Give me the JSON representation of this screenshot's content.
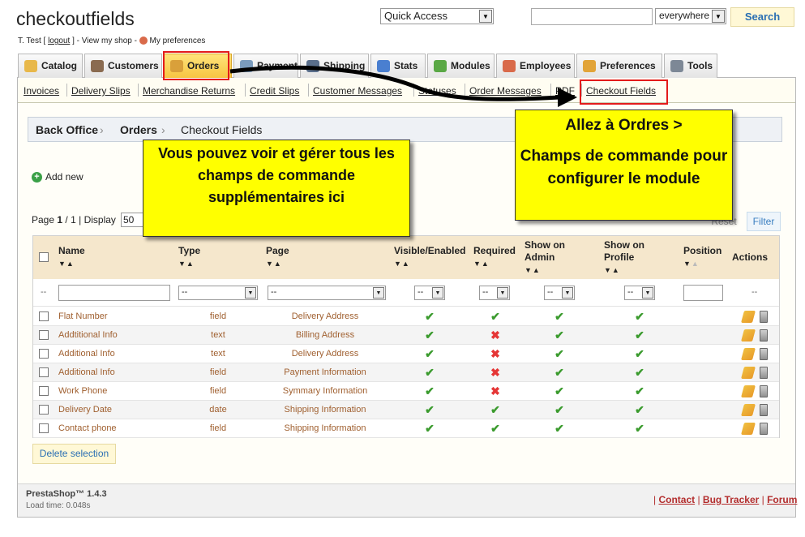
{
  "header": {
    "shop_title": "checkoutfields",
    "user_name": "T. Test",
    "logout_label": "logout",
    "view_shop_label": "View my shop",
    "preferences_label": "My preferences",
    "quick_access": "Quick Access",
    "search_value": "",
    "search_scope": "everywhere",
    "search_button": "Search"
  },
  "tabs": [
    {
      "label": "Catalog",
      "icon": "folder-icon",
      "color": "#e8b84a"
    },
    {
      "label": "Customers",
      "icon": "customer-icon",
      "color": "#8a6b50"
    },
    {
      "label": "Orders",
      "icon": "cart-icon",
      "color": "#d9a03a",
      "active": true
    },
    {
      "label": "Payment",
      "icon": "payment-icon",
      "color": "#7a9bbd"
    },
    {
      "label": "Shipping",
      "icon": "truck-icon",
      "color": "#5a6f8c"
    },
    {
      "label": "Stats",
      "icon": "stats-icon",
      "color": "#4a7fd0"
    },
    {
      "label": "Modules",
      "icon": "puzzle-icon",
      "color": "#5aa845"
    },
    {
      "label": "Employees",
      "icon": "employee-icon",
      "color": "#d96a4a"
    },
    {
      "label": "Preferences",
      "icon": "preferences-icon",
      "color": "#e2a438"
    },
    {
      "label": "Tools",
      "icon": "wrench-icon",
      "color": "#7d8896"
    }
  ],
  "subtabs": [
    "Invoices",
    "Delivery Slips",
    "Merchandise Returns",
    "Credit Slips",
    "Customer Messages",
    "Statuses",
    "Order Messages",
    "PDF",
    "Checkout Fields"
  ],
  "breadcrumb": [
    "Back Office",
    "Orders",
    "Checkout Fields"
  ],
  "add_new_label": "Add new",
  "pager": {
    "page_label": "Page",
    "current": "1",
    "total": "1",
    "display_label": "Display",
    "page_size": "50"
  },
  "reset_label": "Reset",
  "filter_label": "Filter",
  "columns": {
    "name": "Name",
    "type": "Type",
    "page": "Page",
    "visible": "Visible/Enabled",
    "required": "Required",
    "show_admin_1": "Show on",
    "show_admin_2": "Admin",
    "show_profile_1": "Show on",
    "show_profile_2": "Profile",
    "position": "Position",
    "actions": "Actions"
  },
  "filters": {
    "placeholder_dash": "--"
  },
  "rows": [
    {
      "name": "Flat Number",
      "type": "field",
      "page": "Delivery Address",
      "visible": true,
      "required": true,
      "admin": true,
      "profile": true
    },
    {
      "name": "Addtitional Info",
      "type": "text",
      "page": "Billing Address",
      "visible": true,
      "required": false,
      "admin": true,
      "profile": true
    },
    {
      "name": "Additional Info",
      "type": "text",
      "page": "Delivery Address",
      "visible": true,
      "required": false,
      "admin": true,
      "profile": true
    },
    {
      "name": "Additional Info",
      "type": "field",
      "page": "Payment Information",
      "visible": true,
      "required": false,
      "admin": true,
      "profile": true
    },
    {
      "name": "Work Phone",
      "type": "field",
      "page": "Symmary Information",
      "visible": true,
      "required": false,
      "admin": true,
      "profile": true
    },
    {
      "name": "Delivery Date",
      "type": "date",
      "page": "Shipping Information",
      "visible": true,
      "required": true,
      "admin": true,
      "profile": true
    },
    {
      "name": "Contact phone",
      "type": "field",
      "page": "Shipping Information",
      "visible": true,
      "required": true,
      "admin": true,
      "profile": true
    }
  ],
  "delete_selection_label": "Delete selection",
  "footer": {
    "brand": "PrestaShop™ 1.4.3",
    "load_time": "Load time: 0.048s",
    "contact": "Contact",
    "bug_tracker": "Bug Tracker",
    "forum": "Forum"
  },
  "callouts": {
    "manage_text": "Vous pouvez voir et gérer tous les champs de commande supplémentaires ici",
    "goto_line1": "Allez à Ordres >",
    "goto_line2": "Champs de commande pour configurer le module"
  },
  "colors": {
    "highlight": "#e31b1b",
    "callout": "#ffff00",
    "tab_active": "#f7c542",
    "header_row": "#f5e7cc"
  }
}
